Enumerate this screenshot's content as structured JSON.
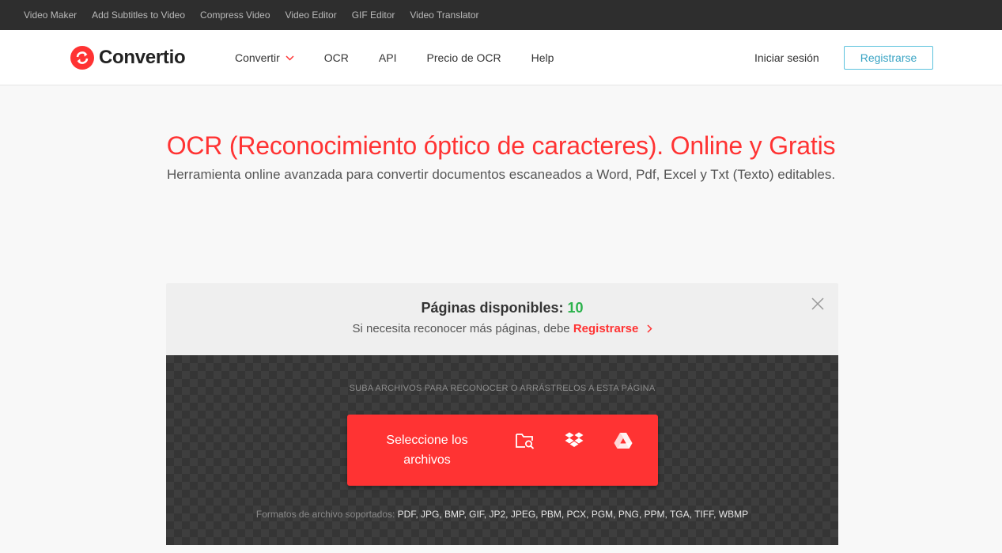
{
  "topbar": {
    "links": [
      "Video Maker",
      "Add Subtitles to Video",
      "Compress Video",
      "Video Editor",
      "GIF Editor",
      "Video Translator"
    ]
  },
  "header": {
    "logo_text": "Convertio",
    "nav": [
      "Convertir",
      "OCR",
      "API",
      "Precio de OCR",
      "Help"
    ],
    "login": "Iniciar sesión",
    "register": "Registrarse"
  },
  "hero": {
    "title": "OCR (Reconocimiento óptico de caracteres). Online y Gratis",
    "subtitle": "Herramienta online avanzada para convertir documentos escaneados a Word, Pdf, Excel y Txt (Texto) editables."
  },
  "box": {
    "pages_label": "Páginas disponibles:",
    "pages_count": "10",
    "signup_text": "Si necesita reconocer más páginas, debe",
    "signup_link": "Registrarse",
    "drop_hint": "SUBA ARCHIVOS PARA RECONOCER O ARRÁSTRELOS A ESTA PÁGINA",
    "select_label": "Seleccione los archivos",
    "formats_label": "Formatos de archivo soportados:",
    "formats_list": "PDF, JPG, BMP, GIF, JP2, JPEG, PBM, PCX, PGM, PNG, PPM, TGA, TIFF, WBMP"
  },
  "colors": {
    "brand_red": "#ff3333",
    "count_green": "#2bb24c",
    "register_border": "#5bc2dd"
  },
  "icons": [
    "convertio-logo-icon",
    "chevron-down-icon",
    "close-icon",
    "chevron-right-icon",
    "folder-search-icon",
    "dropbox-icon",
    "google-drive-icon"
  ]
}
